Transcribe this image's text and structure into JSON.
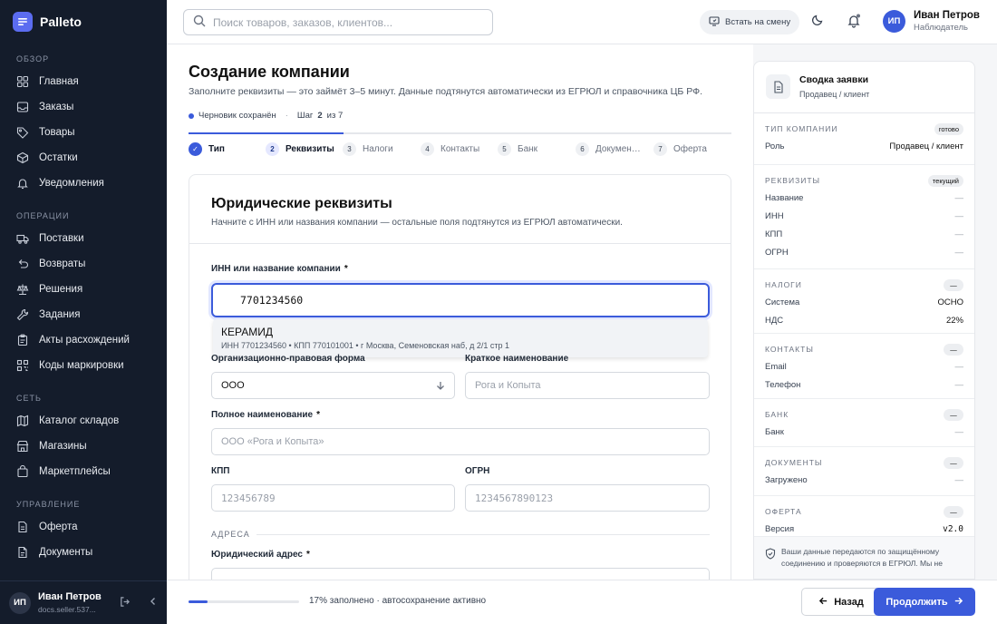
{
  "brand": {
    "name": "Palleto"
  },
  "sidebar": {
    "sections": [
      {
        "title": "ОБЗОР",
        "items": [
          {
            "label": "Главная",
            "icon": "grid-icon"
          },
          {
            "label": "Заказы",
            "icon": "inbox-icon"
          },
          {
            "label": "Товары",
            "icon": "tag-icon"
          },
          {
            "label": "Остатки",
            "icon": "box-icon"
          },
          {
            "label": "Уведомления",
            "icon": "bell-icon"
          }
        ]
      },
      {
        "title": "ОПЕРАЦИИ",
        "items": [
          {
            "label": "Поставки",
            "icon": "truck-icon"
          },
          {
            "label": "Возвраты",
            "icon": "return-icon"
          },
          {
            "label": "Решения",
            "icon": "scale-icon"
          },
          {
            "label": "Задания",
            "icon": "wrench-icon"
          },
          {
            "label": "Акты расхождений",
            "icon": "clipboard-icon"
          },
          {
            "label": "Коды маркировки",
            "icon": "qr-icon"
          }
        ]
      },
      {
        "title": "СЕТЬ",
        "items": [
          {
            "label": "Каталог складов",
            "icon": "map-icon"
          },
          {
            "label": "Магазины",
            "icon": "store-icon"
          },
          {
            "label": "Маркетплейсы",
            "icon": "bag-icon"
          }
        ]
      },
      {
        "title": "УПРАВЛЕНИЕ",
        "items": [
          {
            "label": "Оферта",
            "icon": "file-icon"
          },
          {
            "label": "Документы",
            "icon": "document-icon"
          }
        ]
      }
    ],
    "user": {
      "initials": "ИП",
      "name": "Иван Петров",
      "email": "docs.seller.537..."
    }
  },
  "topbar": {
    "search_placeholder": "Поиск товаров, заказов, клиентов...",
    "shift_label": "Встать на смену",
    "user": {
      "initials": "ИП",
      "name": "Иван Петров",
      "role": "Наблюдатель"
    }
  },
  "page": {
    "title": "Создание компании",
    "subtitle": "Заполните реквизиты — это займёт 3–5 минут. Данные подтянутся автоматически из ЕГРЮЛ и справочника ЦБ РФ.",
    "draft_status": "Черновик сохранён",
    "step_prefix": "Шаг",
    "step_current": "2",
    "step_of": "из 7",
    "progress_steps_fraction": 0.2857
  },
  "steps": [
    {
      "num": "✓",
      "label": "Тип",
      "state": "done"
    },
    {
      "num": "2",
      "label": "Реквизиты",
      "state": "current"
    },
    {
      "num": "3",
      "label": "Налоги",
      "state": "todo"
    },
    {
      "num": "4",
      "label": "Контакты",
      "state": "todo"
    },
    {
      "num": "5",
      "label": "Банк",
      "state": "todo"
    },
    {
      "num": "6",
      "label": "Докумен…",
      "state": "todo"
    },
    {
      "num": "7",
      "label": "Оферта",
      "state": "todo"
    }
  ],
  "form": {
    "title": "Юридические реквизиты",
    "subtitle": "Начните с ИНН или названия компании — остальные поля подтянутся из ЕГРЮЛ автоматически.",
    "inn_label": "ИНН или название компании",
    "req": "*",
    "inn_value": "7701234560",
    "suggestion": {
      "name": "КЕРАМИД",
      "meta": "ИНН 7701234560 • КПП 770101001 • г Москва, Семеновская наб, д 2/1 стр 1"
    },
    "opf_label": "Организационно-правовая форма",
    "opf_value": "ООО",
    "short_label": "Краткое наименование",
    "short_placeholder": "Рога и Копыта",
    "full_label": "Полное наименование",
    "full_placeholder": "ООО «Рога и Копыта»",
    "kpp_label": "КПП",
    "kpp_placeholder": "123456789",
    "ogrn_label": "ОГРН",
    "ogrn_placeholder": "1234567890123",
    "address_section": "АДРЕСА",
    "legal_address_label": "Юридический адрес"
  },
  "bottom": {
    "progress_percent": 17,
    "progress_text": "17% заполнено · автосохранение активно",
    "back_label": "Назад",
    "next_label": "Продолжить"
  },
  "summary": {
    "title": "Сводка заявки",
    "subtitle": "Продавец / клиент",
    "groups": [
      {
        "title": "ТИП КОМПАНИИ",
        "badge": "готово",
        "rows": [
          {
            "k": "Роль",
            "v": "Продавец / клиент",
            "bold": true
          }
        ]
      },
      {
        "title": "РЕКВИЗИТЫ",
        "badge": "текущий",
        "rows": [
          {
            "k": "Название",
            "v": "—"
          },
          {
            "k": "ИНН",
            "v": "—"
          },
          {
            "k": "КПП",
            "v": "—"
          },
          {
            "k": "ОГРН",
            "v": "—"
          }
        ]
      },
      {
        "title": "НАЛОГИ",
        "badge": "—",
        "rows": [
          {
            "k": "Система",
            "v": "ОСНО",
            "bold": true
          },
          {
            "k": "НДС",
            "v": "22%",
            "bold": true
          }
        ]
      },
      {
        "title": "КОНТАКТЫ",
        "badge": "—",
        "rows": [
          {
            "k": "Email",
            "v": "—"
          },
          {
            "k": "Телефон",
            "v": "—"
          }
        ]
      },
      {
        "title": "БАНК",
        "badge": "—",
        "rows": [
          {
            "k": "Банк",
            "v": "—"
          }
        ]
      },
      {
        "title": "ДОКУМЕНТЫ",
        "badge": "—",
        "rows": [
          {
            "k": "Загружено",
            "v": "—"
          }
        ]
      },
      {
        "title": "ОФЕРТА",
        "badge": "—",
        "rows": [
          {
            "k": "Версия",
            "v": "v2.0",
            "bold": true,
            "mono": true
          }
        ]
      }
    ],
    "secure_text": "Ваши данные передаются по защищённому соединению и проверяются в ЕГРЮЛ. Мы не"
  },
  "colors": {
    "accent": "#3b5bdb",
    "sidebar_bg": "#141c2b"
  }
}
